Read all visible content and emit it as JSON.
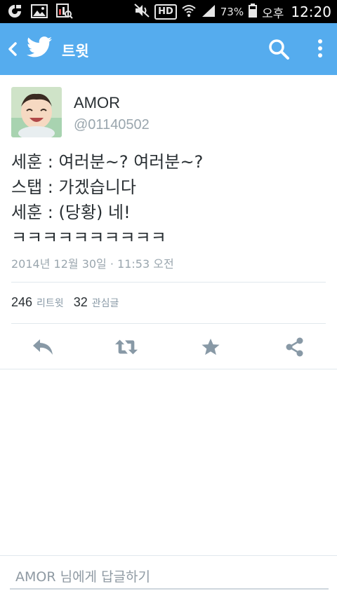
{
  "status_bar": {
    "battery": "73%",
    "hd_label": "HD",
    "ampm": "오후",
    "time": "12:20"
  },
  "app_bar": {
    "title": "트윗",
    "background_color": "#55acee"
  },
  "tweet": {
    "user_name": "AMOR",
    "user_handle": "@01140502",
    "lines": [
      "세훈 : 여러분~? 여러분~?",
      "스탭 : 가겠습니다",
      "세훈 : (당황) 네!",
      "ㅋㅋㅋㅋㅋㅋㅋㅋㅋㅋ"
    ],
    "timestamp": "2014년 12월 30일 · 11:53 오전",
    "stats": {
      "retweet_count": "246",
      "retweet_label": "리트윗",
      "favorite_count": "32",
      "favorite_label": "관심글"
    },
    "actions": [
      "reply-icon",
      "retweet-icon",
      "favorite-star-icon",
      "share-icon"
    ]
  },
  "reply": {
    "placeholder": "AMOR 님에게 답글하기"
  },
  "colors": {
    "accent": "#55acee",
    "icon_gray": "#8899a6",
    "text": "#292f33",
    "muted": "#9aa6ae"
  }
}
